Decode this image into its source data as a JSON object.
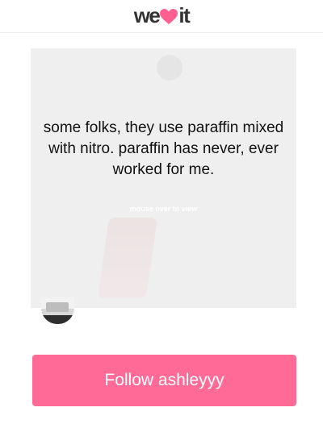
{
  "header": {
    "logo_left": "we",
    "logo_right": "it",
    "brand_color": "#ff5f91"
  },
  "card": {
    "quote": "some folks, they use paraffin mixed with nitro. paraffin has never, ever worked for me.",
    "hint": "mouse over to view"
  },
  "follow_button": {
    "label": "Follow ashleyyy",
    "color": "#ff6a97"
  },
  "icons": {
    "logo_heart": "heart-icon"
  }
}
